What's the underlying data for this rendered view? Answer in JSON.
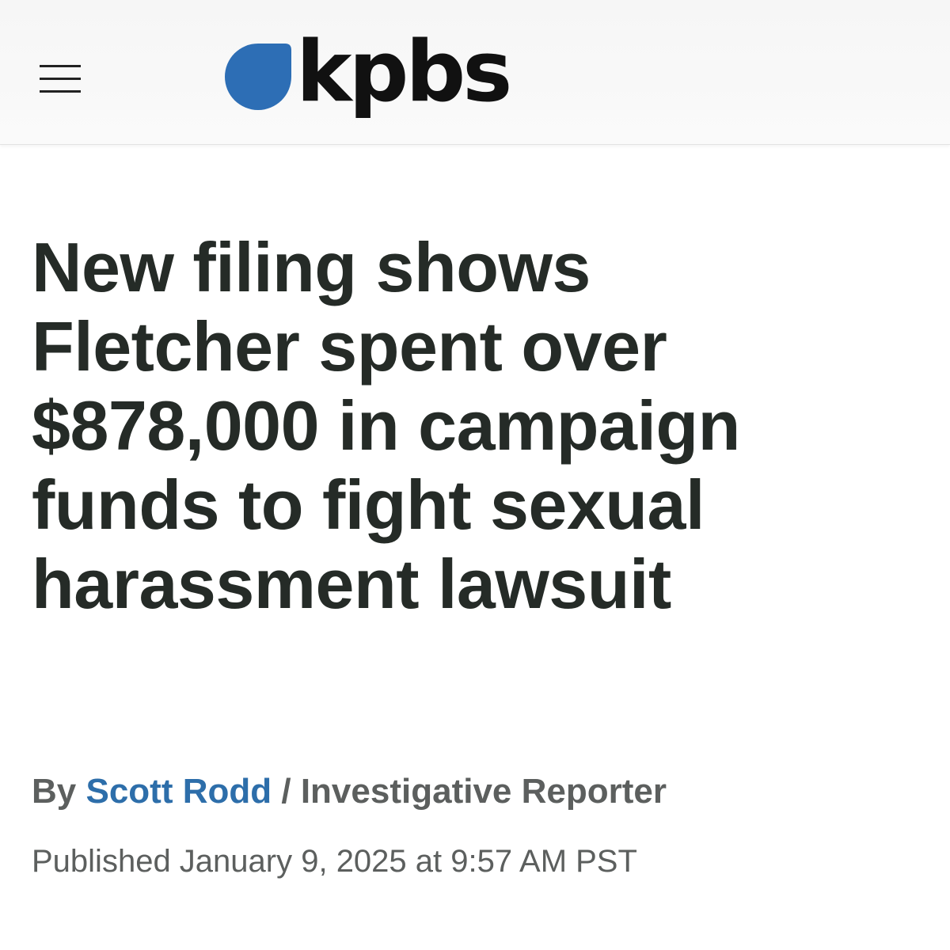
{
  "header": {
    "logo_text": "kpbs",
    "logo_color": "#2d6eb5",
    "menu_icon": "hamburger-menu-icon"
  },
  "article": {
    "headline_lines": [
      "New filing shows",
      "Fletcher spent over",
      "$878,000 in campaign",
      "funds to fight sexual",
      "harassment lawsuit"
    ],
    "byline": {
      "prefix": "By",
      "author": "Scott Rodd",
      "separator": "/",
      "role": "Investigative Reporter"
    },
    "published": "Published January 9, 2025 at 9:57 AM PST"
  },
  "colors": {
    "headline": "#252b27",
    "author_link": "#2d6eaa",
    "meta_text": "#5c5f5e"
  }
}
